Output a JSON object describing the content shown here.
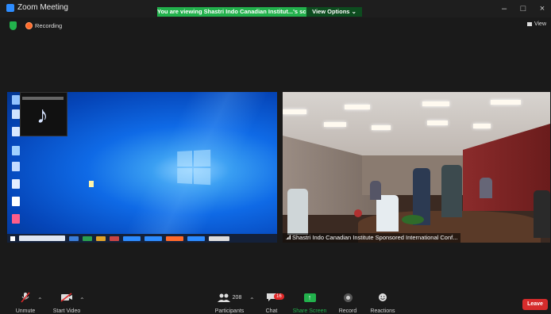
{
  "window": {
    "title": "Zoom Meeting",
    "share_banner": "You are viewing Shastri Indo Canadian Institut...'s screen",
    "view_options": "View Options",
    "minimize": "–",
    "maximize": "□",
    "close": "×"
  },
  "status": {
    "recording_label": "Recording",
    "view_label": "View"
  },
  "videos": {
    "right_caption": "Shastri Indo Canadian Institute Sponsored International Conf..."
  },
  "toolbar": {
    "unmute_label": "Unmute",
    "start_video_label": "Start Video",
    "participants_count": "208",
    "participants_label": "Participants",
    "chat_badge": "16",
    "chat_label": "Chat",
    "share_screen_label": "Share Screen",
    "record_label": "Record",
    "reactions_label": "Reactions",
    "leave_label": "Leave"
  },
  "colors": {
    "share_banner": "#22b14c",
    "leave": "#d62c2c",
    "accent": "#2d8cff"
  },
  "icons": [
    "zoom-logo-icon",
    "shield-icon",
    "record-dot-icon",
    "grid-view-icon",
    "microphone-muted-icon",
    "video-muted-icon",
    "participants-icon",
    "chat-icon",
    "share-screen-icon",
    "record-icon",
    "reactions-icon",
    "chevron-up-icon"
  ]
}
